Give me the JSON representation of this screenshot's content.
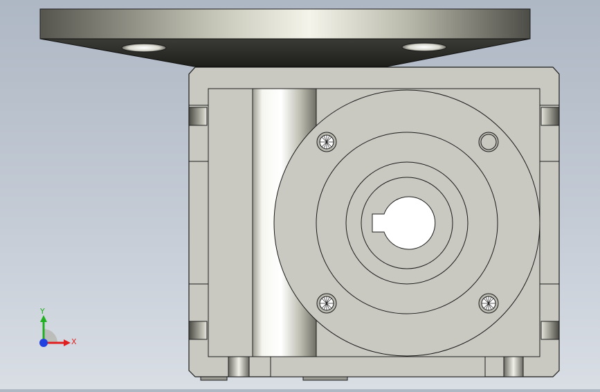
{
  "app": {
    "title": "",
    "view": "front"
  },
  "axis_triad": {
    "x_label": "X",
    "y_label": "Y",
    "x_color": "#e02020",
    "y_color": "#20b020",
    "z_color": "#2040e0"
  },
  "model": {
    "part": "worm-gear-reducer",
    "body_color": "#c9c9c1",
    "edge_color": "#1a1a1a",
    "flange_color": "#6e6e66",
    "mounting_holes_visible": 4,
    "keyway_bore": true
  }
}
